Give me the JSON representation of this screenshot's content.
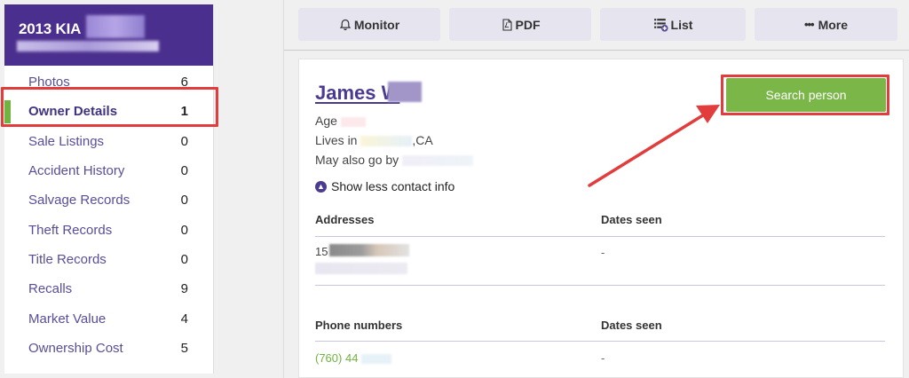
{
  "vehicle": {
    "title": "2013 KIA"
  },
  "sidebar": {
    "items": [
      {
        "label": "Photos",
        "count": "6"
      },
      {
        "label": "Owner Details",
        "count": "1"
      },
      {
        "label": "Sale Listings",
        "count": "0"
      },
      {
        "label": "Accident History",
        "count": "0"
      },
      {
        "label": "Salvage Records",
        "count": "0"
      },
      {
        "label": "Theft Records",
        "count": "0"
      },
      {
        "label": "Title Records",
        "count": "0"
      },
      {
        "label": "Recalls",
        "count": "9"
      },
      {
        "label": "Market Value",
        "count": "4"
      },
      {
        "label": "Ownership Cost",
        "count": "5"
      }
    ]
  },
  "toolbar": {
    "monitor_label": "Monitor",
    "pdf_label": "PDF",
    "list_label": "List",
    "more_label": "More"
  },
  "person": {
    "name": "James W",
    "age_label": "Age",
    "lives_in_label": "Lives in",
    "lives_in_state": ",CA",
    "aka_label": "May also go by",
    "toggle_label": "Show less contact info",
    "search_button": "Search person"
  },
  "addresses": {
    "header": "Addresses",
    "dates_header": "Dates seen",
    "rows": [
      {
        "address_prefix": "15",
        "dates": "-"
      }
    ]
  },
  "phones": {
    "header": "Phone numbers",
    "dates_header": "Dates seen",
    "rows": [
      {
        "phone_prefix": "(760) 44",
        "dates": "-"
      }
    ]
  },
  "colors": {
    "brand_purple": "#4b2f8e",
    "accent_green": "#7ab648",
    "highlight_red": "#e23c3c"
  }
}
